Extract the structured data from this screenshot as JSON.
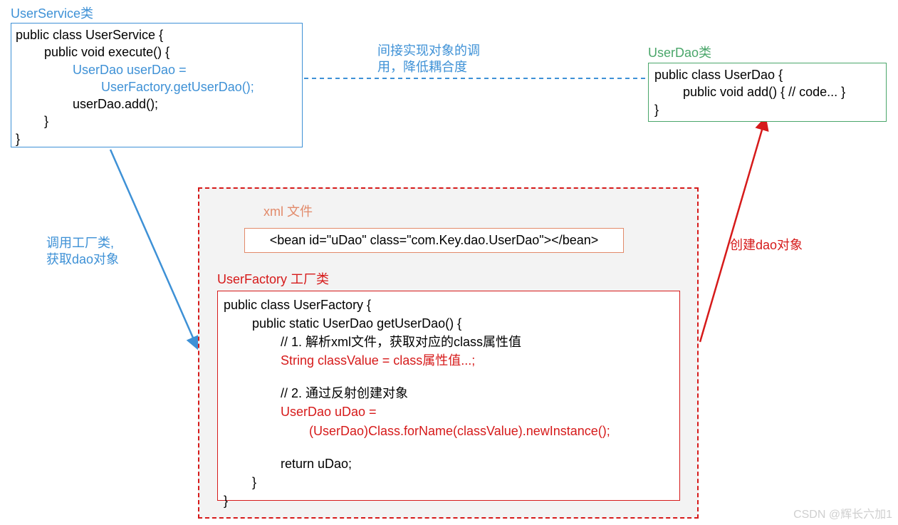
{
  "userService": {
    "title": "UserService类",
    "l1": "public class UserService {",
    "l2": "public void execute() {",
    "l3": "UserDao userDao =",
    "l4": "UserFactory.getUserDao();",
    "l5": "userDao.add();",
    "l6": "}",
    "l7": "}"
  },
  "midNote": {
    "l1": "间接实现对象的调",
    "l2": "用，降低耦合度"
  },
  "userDao": {
    "title": "UserDao类",
    "l1": "public class UserDao {",
    "l2": "public void add() { // code... }",
    "l3": "}"
  },
  "xml": {
    "title": "xml 文件",
    "content": "<bean id=\"uDao\" class=\"com.Key.dao.UserDao\"></bean>"
  },
  "factory": {
    "title": "UserFactory 工厂类",
    "l1": "public class UserFactory {",
    "l2": "public static UserDao getUserDao() {",
    "l3": "// 1. 解析xml文件，获取对应的class属性值",
    "l4": "String classValue = class属性值...;",
    "l5": "// 2. 通过反射创建对象",
    "l6": "UserDao uDao =",
    "l7": "(UserDao)Class.forName(classValue).newInstance();",
    "l8": "return uDao;",
    "l9": "}",
    "l10": "}"
  },
  "leftNote": {
    "l1": "调用工厂类,",
    "l2": "获取dao对象"
  },
  "rightNote": "创建dao对象",
  "watermark": "CSDN @辉长六加1"
}
